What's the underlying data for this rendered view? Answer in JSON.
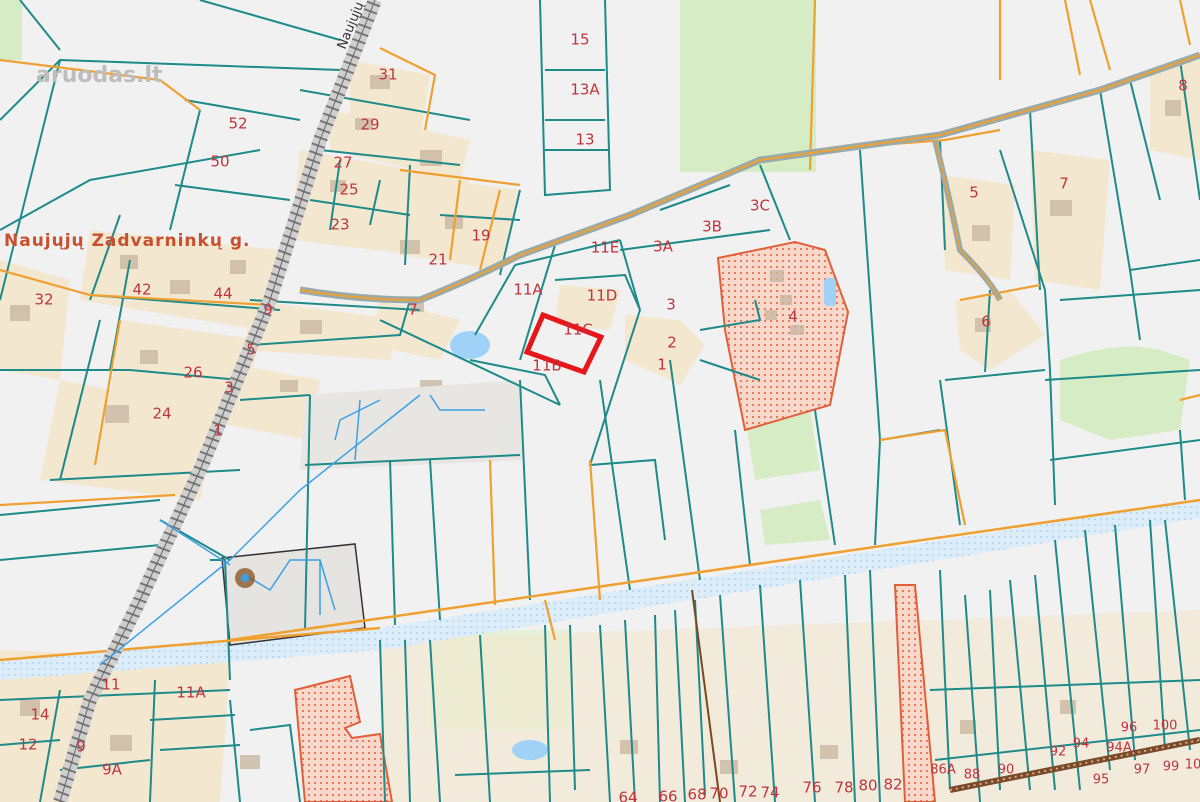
{
  "watermark": "aruodas.lt",
  "street_name": "Naujųjų Zadvarninkų g.",
  "road_name": "Naujųjų",
  "parcel_labels": [
    {
      "id": "p15",
      "text": "15"
    },
    {
      "id": "p13A",
      "text": "13A"
    },
    {
      "id": "p13",
      "text": "13"
    },
    {
      "id": "p31",
      "text": "31"
    },
    {
      "id": "p52",
      "text": "52"
    },
    {
      "id": "p29",
      "text": "29"
    },
    {
      "id": "p50",
      "text": "50"
    },
    {
      "id": "p27",
      "text": "27"
    },
    {
      "id": "p25",
      "text": "25"
    },
    {
      "id": "p23",
      "text": "23"
    },
    {
      "id": "p19",
      "text": "19"
    },
    {
      "id": "p21",
      "text": "21"
    },
    {
      "id": "p42",
      "text": "42"
    },
    {
      "id": "p44",
      "text": "44"
    },
    {
      "id": "p32",
      "text": "32"
    },
    {
      "id": "p9a",
      "text": "9"
    },
    {
      "id": "p7",
      "text": "7"
    },
    {
      "id": "p5a",
      "text": "5"
    },
    {
      "id": "p26",
      "text": "26"
    },
    {
      "id": "p3a",
      "text": "3"
    },
    {
      "id": "p24",
      "text": "24"
    },
    {
      "id": "p1a",
      "text": "1"
    },
    {
      "id": "p11A",
      "text": "11A"
    },
    {
      "id": "p11E",
      "text": "11E"
    },
    {
      "id": "p11D",
      "text": "11D"
    },
    {
      "id": "p11C",
      "text": "11C"
    },
    {
      "id": "p11B",
      "text": "11B"
    },
    {
      "id": "p3A",
      "text": "3A"
    },
    {
      "id": "p3B",
      "text": "3B"
    },
    {
      "id": "p3C",
      "text": "3C"
    },
    {
      "id": "p3b",
      "text": "3"
    },
    {
      "id": "p2",
      "text": "2"
    },
    {
      "id": "p1b",
      "text": "1"
    },
    {
      "id": "p4",
      "text": "4"
    },
    {
      "id": "p5b",
      "text": "5"
    },
    {
      "id": "p7b",
      "text": "7"
    },
    {
      "id": "p6",
      "text": "6"
    },
    {
      "id": "p8",
      "text": "8"
    },
    {
      "id": "p11b",
      "text": "11"
    },
    {
      "id": "p11Ab",
      "text": "11A"
    },
    {
      "id": "p14",
      "text": "14"
    },
    {
      "id": "p12",
      "text": "12"
    },
    {
      "id": "p9b",
      "text": "9"
    },
    {
      "id": "p9A",
      "text": "9A"
    },
    {
      "id": "p64",
      "text": "64"
    },
    {
      "id": "p66",
      "text": "66"
    },
    {
      "id": "p68",
      "text": "68"
    },
    {
      "id": "p70",
      "text": "70"
    },
    {
      "id": "p72",
      "text": "72"
    },
    {
      "id": "p74",
      "text": "74"
    },
    {
      "id": "p76",
      "text": "76"
    },
    {
      "id": "p78",
      "text": "78"
    },
    {
      "id": "p80",
      "text": "80"
    },
    {
      "id": "p82",
      "text": "82"
    },
    {
      "id": "p86A",
      "text": "86A"
    },
    {
      "id": "p88",
      "text": "88"
    },
    {
      "id": "p90",
      "text": "90"
    },
    {
      "id": "p92",
      "text": "92"
    },
    {
      "id": "p94",
      "text": "94"
    },
    {
      "id": "p94A",
      "text": "94A"
    },
    {
      "id": "p96",
      "text": "96"
    },
    {
      "id": "p100",
      "text": "100"
    },
    {
      "id": "p95",
      "text": "95"
    },
    {
      "id": "p97",
      "text": "97"
    },
    {
      "id": "p99",
      "text": "99"
    },
    {
      "id": "p10",
      "text": "10"
    }
  ],
  "highlighted_parcel": "11C",
  "colors": {
    "background": "#f1f1f1",
    "parcel_line": "#1e8a8a",
    "orange_line": "#f0a030",
    "highlight": "#e8151b",
    "green": "#d6ecc4",
    "building_zone": "#f3e7cf",
    "hatched_zone": "#f6c9b8",
    "water": "#5cb8f0",
    "railway": "#7a7a7a"
  }
}
